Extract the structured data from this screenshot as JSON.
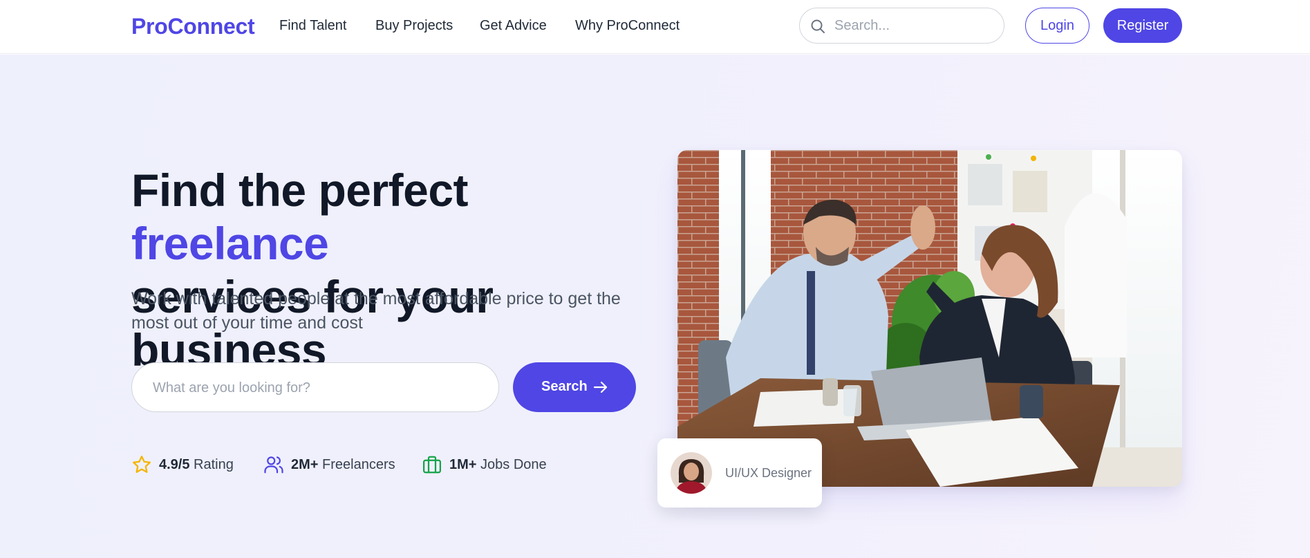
{
  "colors": {
    "accent": "#4f46e5",
    "star": "#f5b400",
    "jobs": "#16a34a",
    "hero_bg": "#eef0fc"
  },
  "nav": {
    "logo": "ProConnect",
    "links": [
      "Find Talent",
      "Buy Projects",
      "Get Advice",
      "Why ProConnect"
    ],
    "search_placeholder": "Search...",
    "login_label": "Login",
    "register_label": "Register",
    "search_icon": "search-icon"
  },
  "hero": {
    "headline_part1": "Find the perfect ",
    "headline_accent": "freelance",
    "headline_part2": "services for your business",
    "subtext": "Work with talented people at the most affordable price to get the most out of your time and cost",
    "search_placeholder": "What are you looking for?",
    "search_button_label": "Search",
    "search_button_icon": "arrow-right-icon",
    "stats": [
      {
        "icon": "star-icon",
        "value": "4.9/5",
        "label": "Rating"
      },
      {
        "icon": "users-icon",
        "value": "2M+",
        "label": "Freelancers"
      },
      {
        "icon": "briefcase-icon",
        "value": "1M+",
        "label": "Jobs Done"
      }
    ],
    "image_icon": "team-high-five-photo",
    "card": {
      "role": "UI/UX Designer",
      "avatar_icon": "avatar-icon"
    }
  }
}
